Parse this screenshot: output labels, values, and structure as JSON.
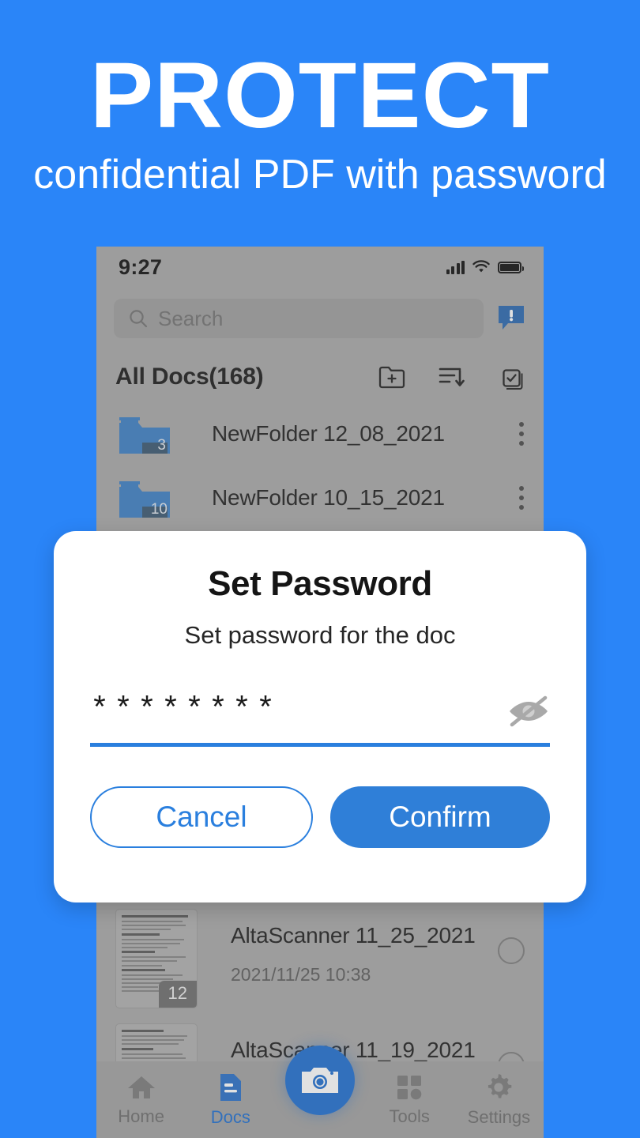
{
  "promo": {
    "headline": "PROTECT",
    "subheadline": "confidential PDF with password",
    "background_color": "#2a85f8"
  },
  "phone": {
    "status_bar": {
      "time": "9:27",
      "signal_icon": "cellular-signal-icon",
      "wifi_icon": "wifi-icon",
      "battery_icon": "battery-icon"
    },
    "search": {
      "placeholder": "Search",
      "icon": "search-icon"
    },
    "feedback_icon": "feedback-bubble-icon",
    "docs_header": {
      "title": "All Docs(168)",
      "actions": [
        {
          "name": "add-folder-icon",
          "label": "Add folder"
        },
        {
          "name": "sort-icon",
          "label": "Sort"
        },
        {
          "name": "select-all-icon",
          "label": "Select"
        }
      ]
    },
    "folders": [
      {
        "name": "NewFolder 12_08_2021",
        "count": "3"
      },
      {
        "name": "NewFolder 10_15_2021",
        "count": "10"
      }
    ],
    "documents": [
      {
        "name": "AltaScanner 11_25_2021",
        "date": "2021/11/25 10:38",
        "pages": "12"
      },
      {
        "name": "AltaScanner 11_19_2021",
        "date": "",
        "pages": ""
      }
    ],
    "bottom_nav": {
      "items": [
        {
          "label": "Home",
          "icon": "home-icon",
          "active": false
        },
        {
          "label": "Docs",
          "icon": "document-icon",
          "active": true
        },
        {
          "label": "Tools",
          "icon": "grid-icon",
          "active": false
        },
        {
          "label": "Settings",
          "icon": "gear-icon",
          "active": false
        }
      ],
      "camera_fab": {
        "icon": "camera-icon",
        "color": "#1f6fd0"
      },
      "active_color": "#1f6fd0",
      "inactive_color": "#6e6e6e"
    }
  },
  "dialog": {
    "title": "Set Password",
    "subtitle": "Set password for the doc",
    "password_value": "********",
    "toggle_visibility_icon": "eye-off-icon",
    "underline_color": "#2a7fde",
    "cancel_label": "Cancel",
    "confirm_label": "Confirm",
    "confirm_color": "#2f7fd8"
  }
}
